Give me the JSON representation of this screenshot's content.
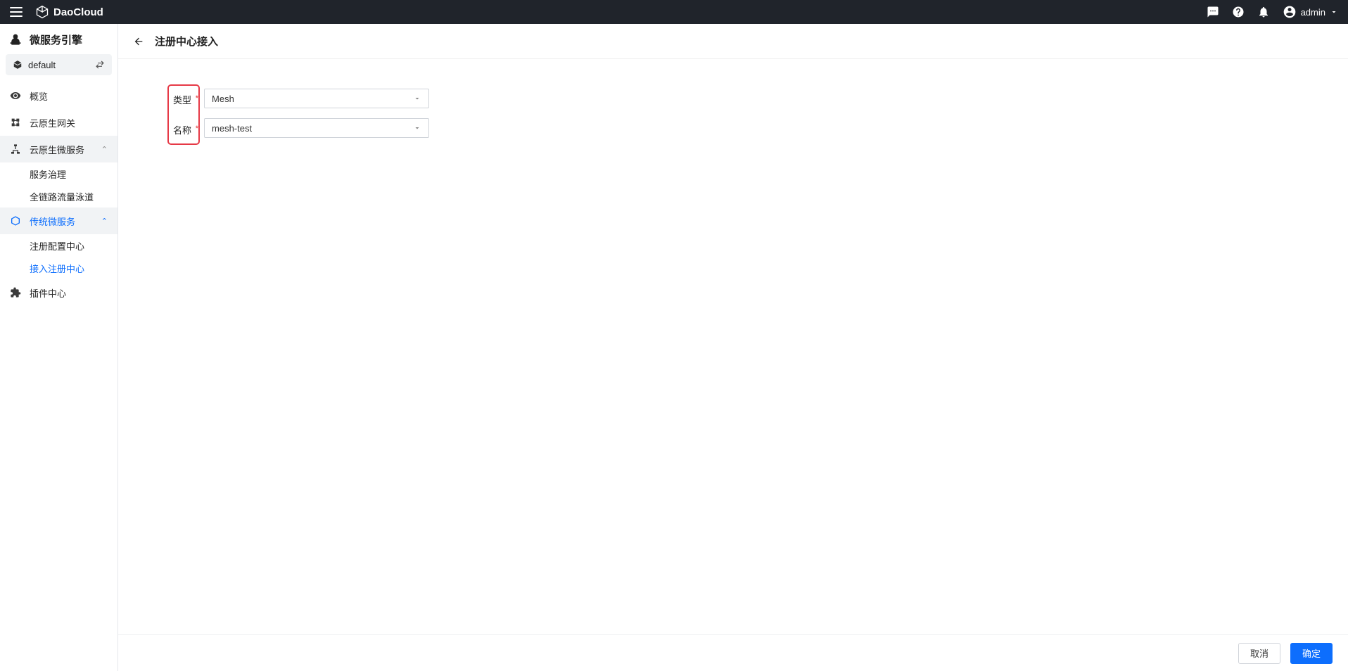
{
  "topbar": {
    "brand": "DaoCloud",
    "user": "admin"
  },
  "sidebar": {
    "title": "微服务引擎",
    "workspace": "default",
    "items": [
      {
        "label": "概览"
      },
      {
        "label": "云原生网关"
      },
      {
        "label": "云原生微服务",
        "children": [
          "服务治理",
          "全链路流量泳道"
        ]
      },
      {
        "label": "传统微服务",
        "active": true,
        "children": [
          "注册配置中心",
          "接入注册中心"
        ]
      },
      {
        "label": "插件中心"
      }
    ]
  },
  "page": {
    "title": "注册中心接入",
    "form": {
      "type_label": "类型",
      "type_value": "Mesh",
      "name_label": "名称",
      "name_value": "mesh-test"
    },
    "actions": {
      "cancel": "取消",
      "confirm": "确定"
    }
  }
}
